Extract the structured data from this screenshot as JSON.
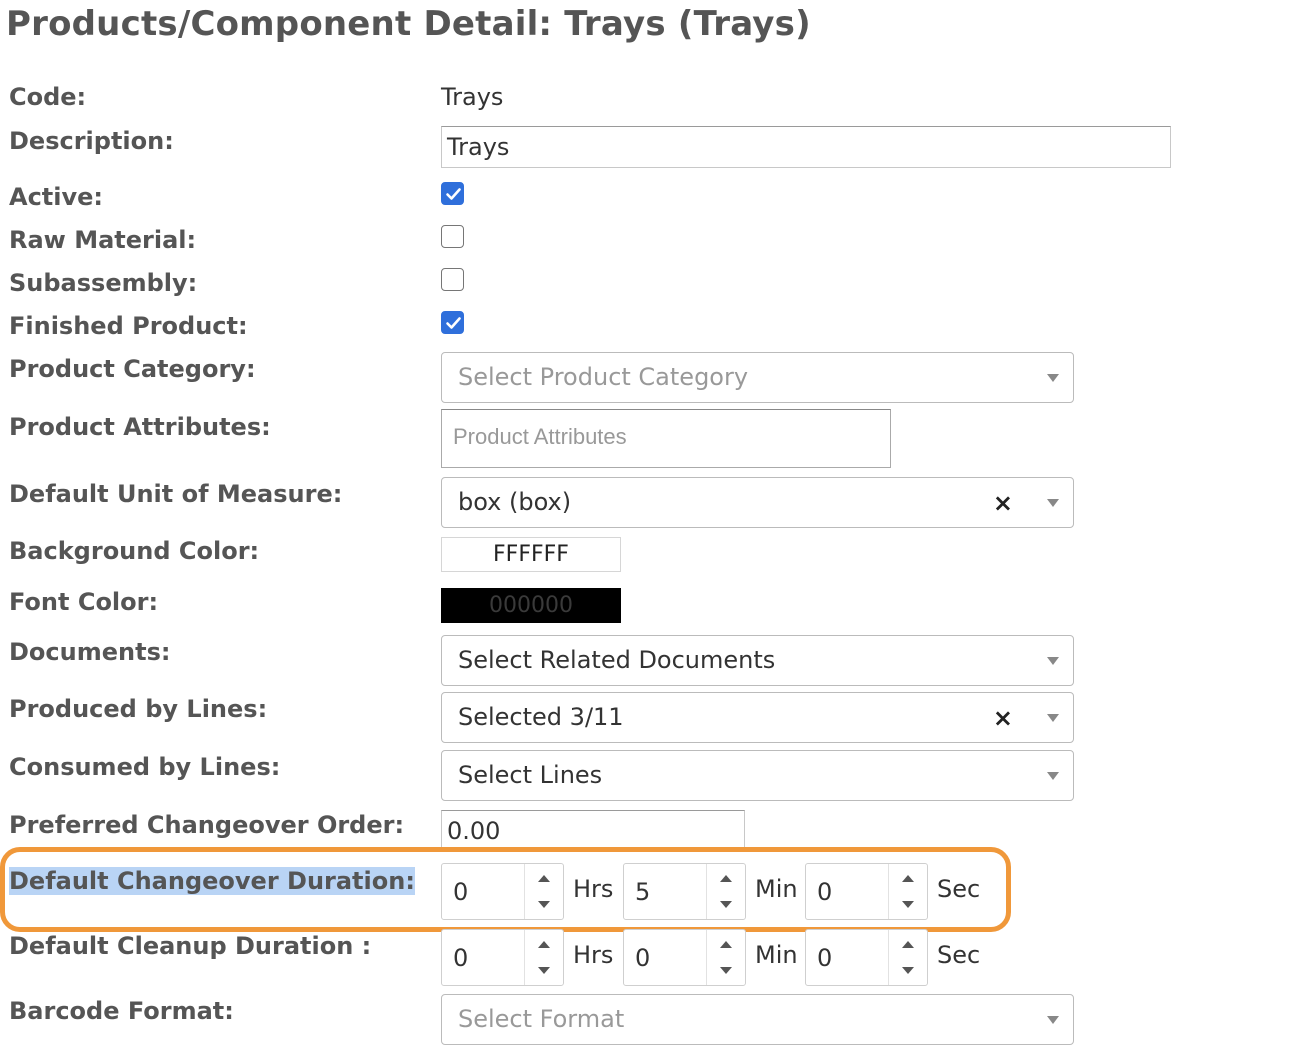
{
  "page_title": "Products/Component Detail: Trays (Trays)",
  "labels": {
    "code": "Code:",
    "description": "Description:",
    "active": "Active:",
    "raw_material": "Raw Material:",
    "subassembly": "Subassembly:",
    "finished_product": "Finished Product:",
    "product_category": "Product Category:",
    "product_attributes": "Product Attributes:",
    "default_uom": "Default Unit of Measure:",
    "background_color": "Background Color:",
    "font_color": "Font Color:",
    "documents": "Documents:",
    "produced_by_lines": "Produced by Lines:",
    "consumed_by_lines": "Consumed by Lines:",
    "preferred_changeover_order": "Preferred Changeover Order:",
    "default_changeover_duration": "Default Changeover Duration:",
    "default_cleanup_duration": "Default Cleanup Duration :",
    "barcode_format": "Barcode Format:"
  },
  "values": {
    "code": "Trays",
    "description": "Trays",
    "active": true,
    "raw_material": false,
    "subassembly": false,
    "finished_product": true,
    "product_category_placeholder": "Select Product Category",
    "product_attributes_placeholder": "Product Attributes",
    "default_uom": "box (box)",
    "background_color": "FFFFFF",
    "font_color": "000000",
    "documents_placeholder": "Select Related Documents",
    "produced_by_lines": "Selected 3/11",
    "consumed_by_lines_placeholder": "Select Lines",
    "preferred_changeover_order": "0.00",
    "changeover": {
      "hrs": "0",
      "min": "5",
      "sec": "0"
    },
    "cleanup": {
      "hrs": "0",
      "min": "0",
      "sec": "0"
    },
    "barcode_format_placeholder": "Select Format"
  },
  "units": {
    "hrs": "Hrs",
    "min": "Min",
    "sec": "Sec"
  },
  "icons": {
    "clear": "×"
  },
  "colors": {
    "highlight": "#f0983a",
    "checkbox": "#2f6fdb",
    "label_selection": "#b9d4f5"
  }
}
